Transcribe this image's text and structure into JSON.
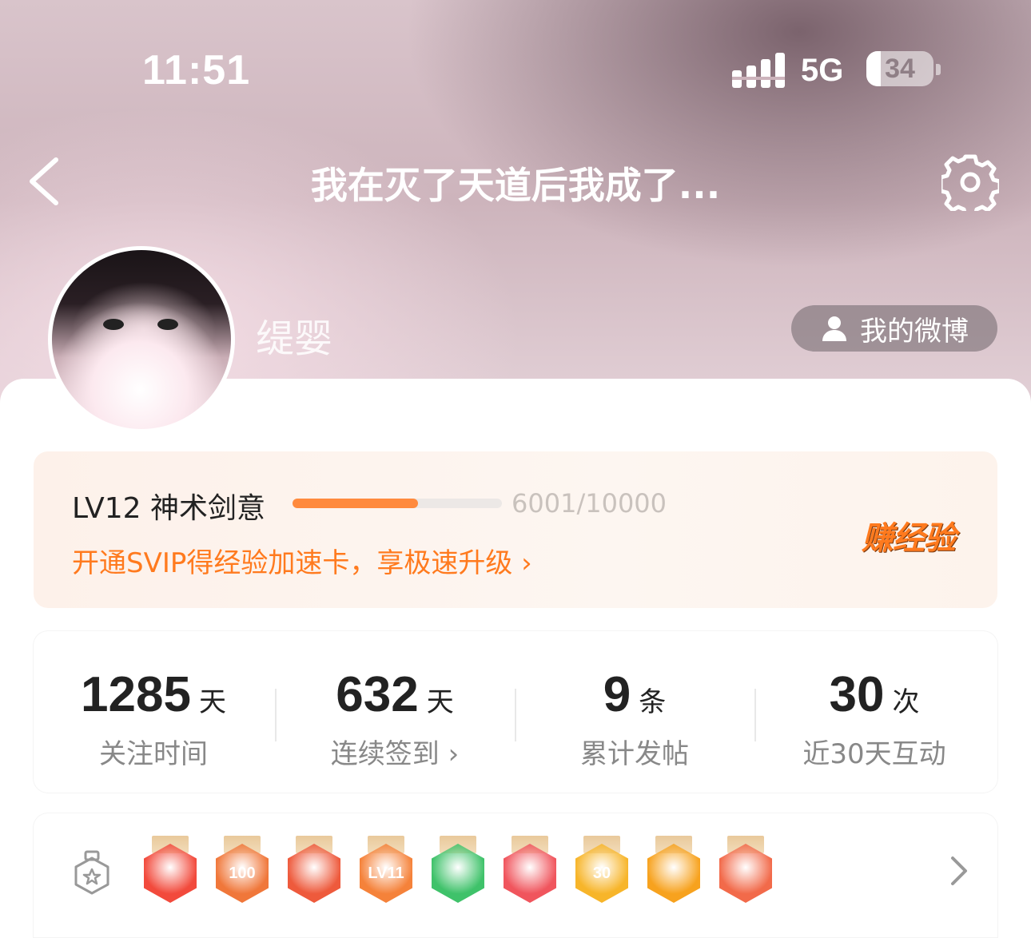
{
  "status_bar": {
    "time": "11:51",
    "network": "5G",
    "battery": "34"
  },
  "header": {
    "title": "我在灭了天道后我成了..."
  },
  "profile": {
    "name": "缇婴",
    "weibo_button": "我的微博"
  },
  "level": {
    "name": "LV12 神术剑意",
    "progress_text": "6001/10000",
    "progress_fraction": 0.6001,
    "promo": "开通SVIP得经验加速卡，享极速升级 ›",
    "earn_label": "赚经验"
  },
  "stats": [
    {
      "value": "1285",
      "unit": "天",
      "label": "关注时间"
    },
    {
      "value": "632",
      "unit": "天",
      "label": "连续签到 ›"
    },
    {
      "value": "9",
      "unit": "条",
      "label": "累计发帖"
    },
    {
      "value": "30",
      "unit": "次",
      "label": "近30天互动"
    }
  ],
  "badges": [
    {
      "icon": "cat-badge-icon",
      "text": "",
      "color": "#f24a3c"
    },
    {
      "icon": "100-days-badge-icon",
      "text": "100",
      "color": "#f0773a"
    },
    {
      "icon": "cat-face-badge-icon",
      "text": "",
      "color": "#ee5a3c"
    },
    {
      "icon": "lv11-badge-icon",
      "text": "LV11",
      "color": "#f5823a"
    },
    {
      "icon": "hand-badge-icon",
      "text": "",
      "color": "#3fc26a"
    },
    {
      "icon": "trophy-badge-icon",
      "text": "",
      "color": "#f0555d"
    },
    {
      "icon": "30-days-badge-icon",
      "text": "30",
      "color": "#f7b52a"
    },
    {
      "icon": "laugh-badge-icon",
      "text": "",
      "color": "#f7a21e"
    },
    {
      "icon": "rock-hand-badge-icon",
      "text": "",
      "color": "#f26a4a"
    }
  ]
}
